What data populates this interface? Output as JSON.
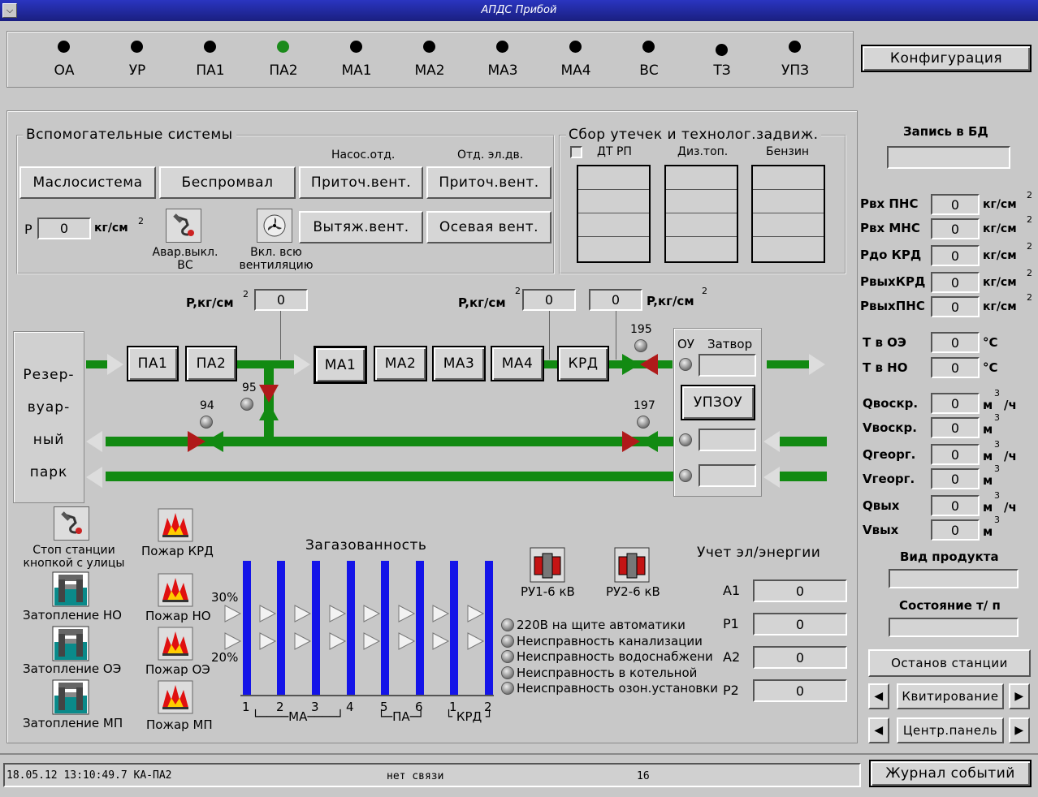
{
  "window": {
    "title": "АПДС Прибой"
  },
  "top_indicators": [
    {
      "label": "ОА",
      "state": "off"
    },
    {
      "label": "УР",
      "state": "off"
    },
    {
      "label": "ПА1",
      "state": "off"
    },
    {
      "label": "ПА2",
      "state": "on"
    },
    {
      "label": "МА1",
      "state": "off"
    },
    {
      "label": "МА2",
      "state": "off"
    },
    {
      "label": "МА3",
      "state": "off"
    },
    {
      "label": "МА4",
      "state": "off"
    },
    {
      "label": "ВС",
      "state": "off"
    },
    {
      "label": "ТЗ",
      "state": "off"
    },
    {
      "label": "УПЗ",
      "state": "off"
    }
  ],
  "config_button": "Конфигурация",
  "aux": {
    "title": "Вспомогательные системы",
    "oil": "Маслосистема",
    "bespromval": "Беспромвал",
    "pump_dept": "Насос.отд.",
    "motor_dept": "Отд. эл.дв.",
    "supply1": "Приточ.вент.",
    "supply2": "Приточ.вент.",
    "exhaust": "Вытяж.вент.",
    "axial": "Осевая вент.",
    "p_label": "P",
    "p_value": "0",
    "p_unit": "кг/см",
    "p_exp": "2",
    "emerg_label": "Авар.выкл. ВС",
    "vent_label": "Вкл. всю вентиляцию"
  },
  "leaks": {
    "title": "Сбор утечек и технолог.задвиж.",
    "col1": "ДТ РП",
    "col2": "Диз.топ.",
    "col3": "Бензин"
  },
  "right": {
    "db_title": "Запись в БД",
    "db_value": "",
    "pressures": [
      {
        "label": "Pвх ПНС",
        "value": "0",
        "unit": "кг/см",
        "exp": "2"
      },
      {
        "label": "Pвх МНС",
        "value": "0",
        "unit": "кг/см",
        "exp": "2"
      },
      {
        "label": "Pдо КРД",
        "value": "0",
        "unit": "кг/см",
        "exp": "2"
      },
      {
        "label": "PвыхКРД",
        "value": "0",
        "unit": "кг/см",
        "exp": "2"
      },
      {
        "label": "PвыхПНС",
        "value": "0",
        "unit": "кг/см",
        "exp": "2"
      }
    ],
    "temps": [
      {
        "label": "T в ОЭ",
        "value": "0",
        "unit": "°C"
      },
      {
        "label": "T в НО",
        "value": "0",
        "unit": "°C"
      }
    ],
    "flows": [
      {
        "label": "Qвоскр.",
        "value": "0",
        "unit": "м",
        "exp": "3",
        "suffix": "/ч"
      },
      {
        "label": "Vвоскр.",
        "value": "0",
        "unit": "м",
        "exp": "3",
        "suffix": ""
      },
      {
        "label": "Qгеорг.",
        "value": "0",
        "unit": "м",
        "exp": "3",
        "suffix": "/ч"
      },
      {
        "label": "Vгеорг.",
        "value": "0",
        "unit": "м",
        "exp": "3",
        "suffix": ""
      },
      {
        "label": "Qвых",
        "value": "0",
        "unit": "м",
        "exp": "3",
        "suffix": "/ч"
      },
      {
        "label": "Vвых",
        "value": "0",
        "unit": "м",
        "exp": "3",
        "suffix": ""
      }
    ],
    "product_title": "Вид продукта",
    "product_value": "",
    "state_title": "Состояние т/ п",
    "state_value": "",
    "stop_btn": "Останов станции",
    "ack_btn": "Квитирование",
    "central_btn": "Центр.панель"
  },
  "scheme": {
    "reservoir": [
      "Резер-",
      "вуар-",
      "ный",
      "парк"
    ],
    "pumps_pa": [
      "ПА1",
      "ПА2"
    ],
    "pumps_ma": [
      "МА1",
      "МА2",
      "МА3",
      "МА4"
    ],
    "krd": "КРД",
    "p_label1": "P,кг/см",
    "p_exp": "2",
    "p_val1": "0",
    "p_label2": "P,кг/см",
    "p_val2": "0",
    "p_val3": "0",
    "p_label3": "P,кг/см",
    "valves": {
      "v195": "195",
      "v95": "95",
      "v94": "94",
      "v197": "197"
    },
    "ou": "ОУ",
    "gate": "Затвор",
    "upzou": "УПЗОУ"
  },
  "alarms_left": {
    "stop_street": "Стоп станции кнопкой с улицы",
    "flood_no": "Затопление НО",
    "flood_oe": "Затопление ОЭ",
    "flood_mp": "Затопление МП",
    "fire_krd": "Пожар КРД",
    "fire_no": "Пожар НО",
    "fire_oe": "Пожар ОЭ",
    "fire_mp": "Пожар МП"
  },
  "gas": {
    "title": "Загазованность",
    "level_high": "30%",
    "level_low": "20%",
    "bars": [
      "1",
      "2",
      "3",
      "4",
      "5",
      "6",
      "1",
      "2"
    ],
    "group_ma": "МА",
    "group_pa": "ПА",
    "group_krd": "КРД"
  },
  "ru": {
    "ru1": "РУ1-6 кВ",
    "ru2": "РУ2-6 кВ"
  },
  "faults": [
    "220В на щите автоматики",
    "Неисправность канализации",
    "Неисправность водоснабжени",
    "Неисправность в котельной",
    "Неисправность озон.установки"
  ],
  "energy": {
    "title": "Учет эл/энергии",
    "rows": [
      {
        "label": "A1",
        "value": "0"
      },
      {
        "label": "P1",
        "value": "0"
      },
      {
        "label": "A2",
        "value": "0"
      },
      {
        "label": "P2",
        "value": "0"
      }
    ]
  },
  "status": {
    "datetime": "18.05.12 13:10:49.7 КА-ПА2",
    "link": "нет связи",
    "count": "16",
    "journal_btn": "Журнал событий"
  },
  "colors": {
    "pipe": "#128a12",
    "gas_bar": "#1414e8",
    "indicator_on": "#1b8a1b",
    "title_bar": "#1a1f80"
  }
}
